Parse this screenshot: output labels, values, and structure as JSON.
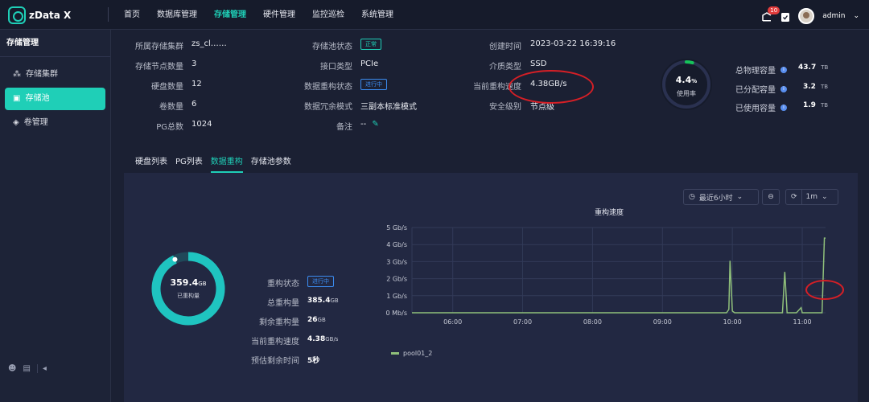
{
  "app": {
    "name": "zData X"
  },
  "nav": [
    {
      "label": "首页"
    },
    {
      "label": "数据库管理"
    },
    {
      "label": "存储管理"
    },
    {
      "label": "硬件管理"
    },
    {
      "label": "监控巡检"
    },
    {
      "label": "系统管理"
    }
  ],
  "header": {
    "notification_count": "10",
    "user": "admin"
  },
  "sidebar": {
    "title": "存储管理",
    "items": [
      {
        "label": "存储集群"
      },
      {
        "label": "存储池"
      },
      {
        "label": "卷管理"
      }
    ]
  },
  "pool_info": {
    "col1": [
      {
        "label": "所属存储集群",
        "value": "zs_cl……"
      },
      {
        "label": "存储节点数量",
        "value": "3"
      },
      {
        "label": "硬盘数量",
        "value": "12"
      },
      {
        "label": "卷数量",
        "value": "6"
      },
      {
        "label": "PG总数",
        "value": "1024"
      }
    ],
    "col2": [
      {
        "label": "存储池状态",
        "value": "正常"
      },
      {
        "label": "接口类型",
        "value": "PCIe"
      },
      {
        "label": "数据重构状态",
        "value": "进行中"
      },
      {
        "label": "数据冗余模式",
        "value": "三副本标准模式"
      },
      {
        "label": "备注",
        "value": "--"
      }
    ],
    "col3": [
      {
        "label": "创建时间",
        "value": "2023-03-22 16:39:16"
      },
      {
        "label": "介质类型",
        "value": "SSD"
      },
      {
        "label": "当前重构速度",
        "value": "4.38GB/s"
      },
      {
        "label": "安全级别",
        "value": "节点级"
      }
    ]
  },
  "usage": {
    "percent_text": "4.4",
    "percent_sign": "%",
    "label": "使用率",
    "fraction": 0.044
  },
  "capacity": [
    {
      "label": "总物理容量",
      "value": "43.7",
      "unit": "TB"
    },
    {
      "label": "已分配容量",
      "value": "3.2",
      "unit": "TB"
    },
    {
      "label": "已使用容量",
      "value": "1.9",
      "unit": "TB"
    }
  ],
  "tabs": [
    {
      "label": "硬盘列表"
    },
    {
      "label": "PG列表"
    },
    {
      "label": "数据重构"
    },
    {
      "label": "存储池参数"
    }
  ],
  "controls": {
    "range": "最近6小时",
    "interval": "1m"
  },
  "rebuild": {
    "ring_value": "359.4",
    "ring_unit": "GB",
    "ring_label": "已重构量",
    "fraction": 0.932,
    "stats": [
      {
        "label": "重构状态",
        "value": "进行中",
        "unit": ""
      },
      {
        "label": "总重构量",
        "value": "385.4",
        "unit": "GB"
      },
      {
        "label": "剩余重构量",
        "value": "26",
        "unit": "GB"
      },
      {
        "label": "当前重构速度",
        "value": "4.38",
        "unit": "GB/s"
      },
      {
        "label": "预估剩余时间",
        "value": "5秒",
        "unit": ""
      }
    ]
  },
  "chart_data": {
    "type": "line",
    "title": "重构速度",
    "xlabel": "",
    "ylabel": "",
    "ylim": [
      0,
      5
    ],
    "yticks": [
      "0 Mb/s",
      "1 Gb/s",
      "2 Gb/s",
      "3 Gb/s",
      "4 Gb/s",
      "5 Gb/s"
    ],
    "xticks": [
      "06:00",
      "07:00",
      "08:00",
      "09:00",
      "10:00",
      "11:00"
    ],
    "grid": true,
    "legend": "bottom-left",
    "series": [
      {
        "name": "pool01_2",
        "color": "#8fbf7a",
        "x": [
          "05:25",
          "09:55",
          "09:57",
          "09:58",
          "10:00",
          "10:02",
          "10:43",
          "10:45",
          "10:47",
          "10:55",
          "10:59",
          "11:00",
          "11:02",
          "11:17",
          "11:19",
          "11:20"
        ],
        "y": [
          0,
          0,
          0.2,
          3.05,
          0.1,
          0,
          0,
          2.4,
          0,
          0,
          0.3,
          0,
          0,
          0,
          4.38,
          4.38
        ]
      }
    ]
  }
}
